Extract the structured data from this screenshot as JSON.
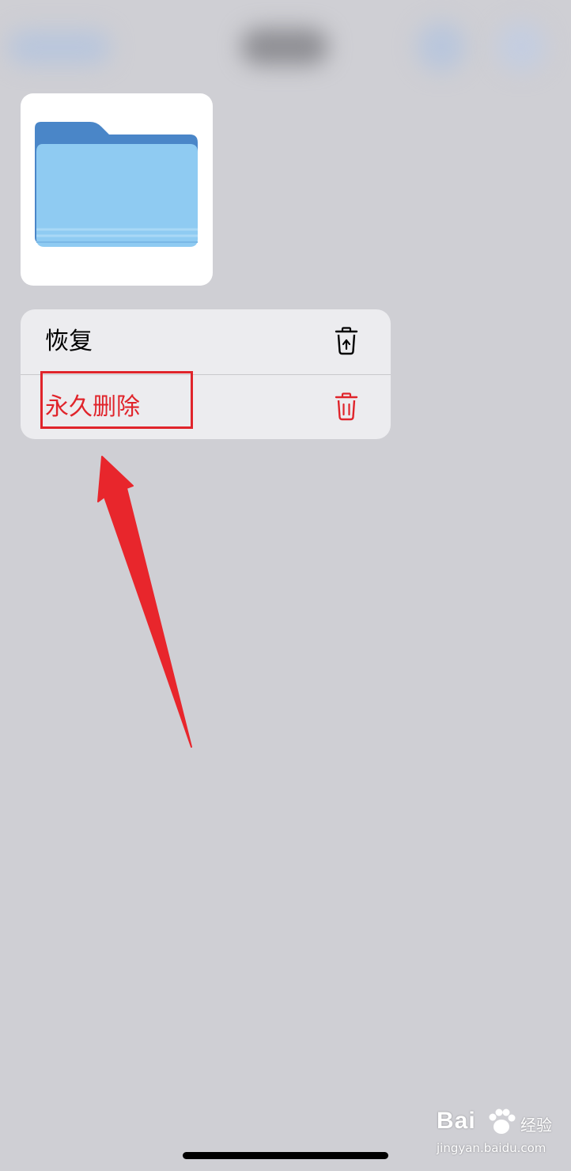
{
  "context_menu": {
    "items": [
      {
        "label": "恢复",
        "icon": "restore-trash-icon",
        "color": "#000000"
      },
      {
        "label": "永久删除",
        "icon": "trash-icon",
        "color": "#e0242b"
      }
    ]
  },
  "preview": {
    "icon": "folder-icon",
    "folder_color": "#8fcbf2"
  },
  "annotation": {
    "color": "#e0242b"
  },
  "watermark": {
    "brand": "Bai",
    "product": "经验",
    "url": "jingyan.baidu.com"
  }
}
